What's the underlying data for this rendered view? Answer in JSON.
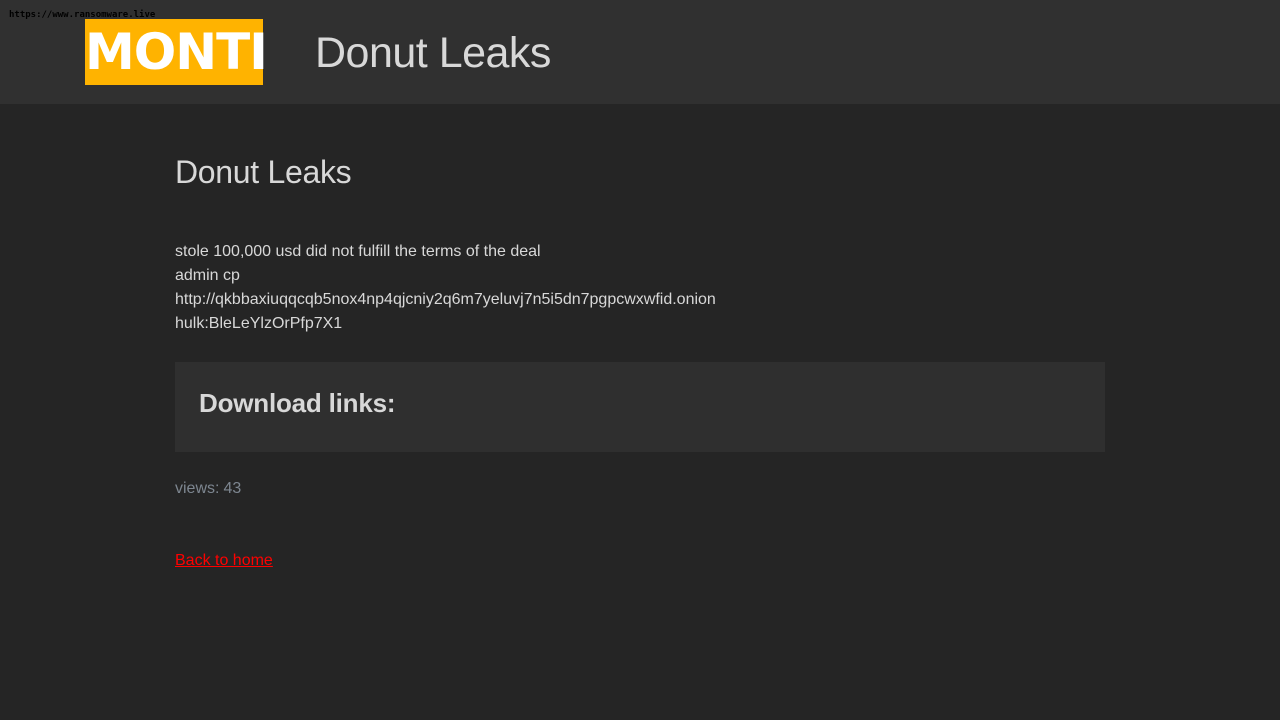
{
  "watermark": {
    "url_text": "https://www.ransomware.live"
  },
  "header": {
    "logo_text": "MONTI",
    "logo_color": "#ffb300",
    "site_title": "Donut Leaks"
  },
  "main": {
    "title": "Donut Leaks",
    "details": [
      "stole 100,000 usd did not fulfill the terms of the deal",
      "admin cp",
      "http://qkbbaxiuqqcqb5nox4np4qjcniy2q6m7yeluvj7n5i5dn7pgpcwxwfid.onion",
      "hulk:BleLeYlzOrPfp7X1"
    ],
    "download_heading": "Download links:",
    "views_label": "views:",
    "views_count": "43",
    "back_link": "Back to home",
    "link_color": "#ff0000"
  }
}
